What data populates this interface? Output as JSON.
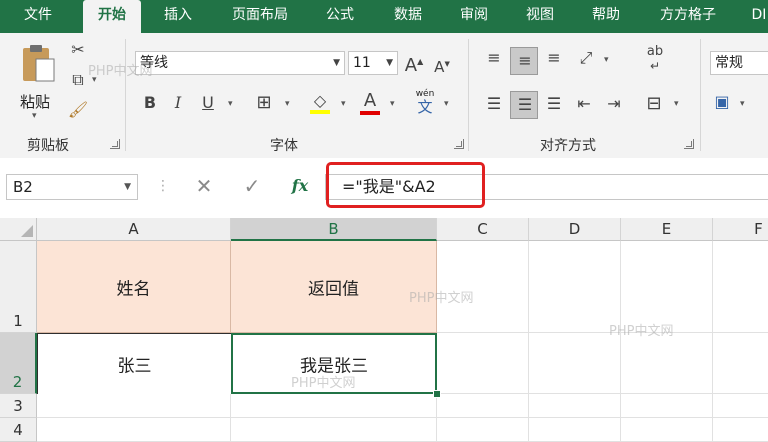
{
  "tabs": [
    "文件",
    "开始",
    "插入",
    "页面布局",
    "公式",
    "数据",
    "审阅",
    "视图",
    "帮助",
    "方方格子",
    "DI"
  ],
  "active_tab": "开始",
  "ribbon": {
    "clipboard": {
      "label": "剪贴板",
      "paste_label": "粘贴"
    },
    "font": {
      "label": "字体",
      "font_name": "等线",
      "font_size": "11",
      "bold": "B",
      "italic": "I",
      "underline": "U",
      "font_color_glyph": "A",
      "phonetic_glyph": "文",
      "phonetic_top": "wén"
    },
    "alignment": {
      "label": "对齐方式",
      "wrap_glyph": "ab"
    },
    "number": {
      "format": "常规"
    }
  },
  "formula_bar": {
    "name_box": "B2",
    "fx": "fx",
    "formula": "=\"我是\"&A2"
  },
  "grid": {
    "columns": [
      "A",
      "B",
      "C",
      "D",
      "E",
      "F"
    ],
    "rows": [
      "1",
      "2",
      "3",
      "4"
    ],
    "cells": {
      "A1": "姓名",
      "B1": "返回值",
      "A2": "张三",
      "B2": "我是张三"
    }
  },
  "watermark": "PHP中文网",
  "colors": {
    "excel_green": "#217346",
    "header_fill": "#fce4d6",
    "highlight_red": "#e02020"
  }
}
